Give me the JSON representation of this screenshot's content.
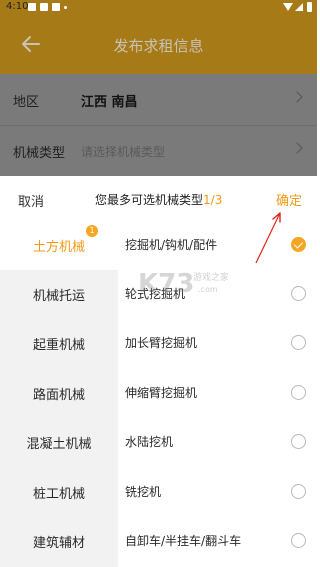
{
  "status_bar": {
    "time": "4:10"
  },
  "app_bar": {
    "title": "发布求租信息"
  },
  "form": {
    "region": {
      "label": "地区",
      "value": "江西 南昌"
    },
    "machine_type": {
      "label": "机械类型",
      "placeholder": "请选择机械类型"
    }
  },
  "picker": {
    "cancel": "取消",
    "hint": "您最多可选机械类型",
    "count": "1/3",
    "confirm": "确定"
  },
  "categories": [
    {
      "label": "土方机械",
      "active": true,
      "badge": "1"
    },
    {
      "label": "机械托运"
    },
    {
      "label": "起重机械"
    },
    {
      "label": "路面机械"
    },
    {
      "label": "混凝土机械"
    },
    {
      "label": "桩工机械"
    },
    {
      "label": "建筑辅材"
    }
  ],
  "subtypes": [
    {
      "label": "挖掘机/钩机/配件",
      "checked": true
    },
    {
      "label": "轮式挖掘机",
      "checked": false
    },
    {
      "label": "加长臂挖掘机",
      "checked": false
    },
    {
      "label": "伸缩臂挖掘机",
      "checked": false
    },
    {
      "label": "水陆挖机",
      "checked": false
    },
    {
      "label": "铣挖机",
      "checked": false
    },
    {
      "label": "自卸车/半挂车/翻斗车",
      "checked": false
    }
  ],
  "watermark": {
    "text": "K73 游戏之家",
    "sub": ".com"
  },
  "colors": {
    "accent": "#f39a17",
    "appbar": "#a67a17",
    "overlay": "#7a7a7a",
    "annotation": "#e0251b"
  }
}
